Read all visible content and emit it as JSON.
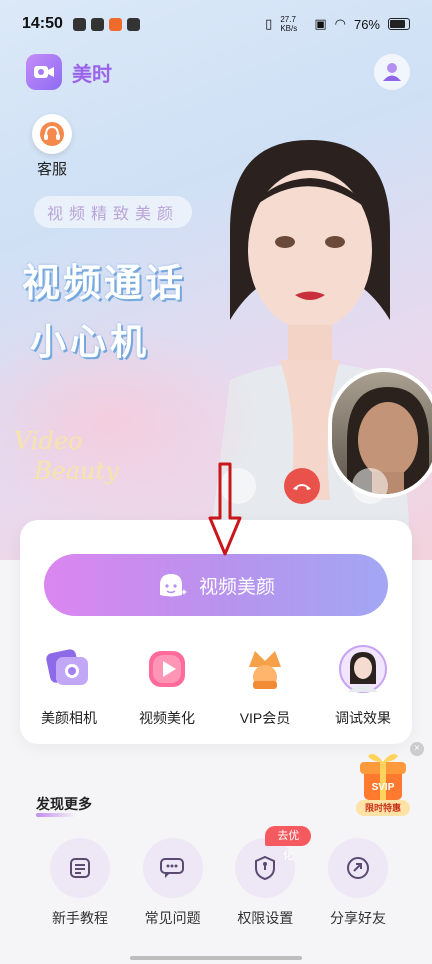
{
  "status_bar": {
    "time": "14:50",
    "network_speed": "27.7 KB/s",
    "battery": "76%"
  },
  "app": {
    "name": "美时"
  },
  "hero": {
    "service_label": "客服",
    "tagline": "视频精致美颜",
    "headline_line1": "视频通话",
    "headline_line2": "小心机",
    "script_line1": "Video",
    "script_line2": "Beauty"
  },
  "main_button": {
    "label": "视频美颜"
  },
  "features": [
    {
      "label": "美颜相机",
      "icon": "camera-icon"
    },
    {
      "label": "视频美化",
      "icon": "play-icon"
    },
    {
      "label": "VIP会员",
      "icon": "crown-icon"
    },
    {
      "label": "调试效果",
      "icon": "avatar-icon"
    }
  ],
  "promo": {
    "badge": "SVIP",
    "label": "限时特惠"
  },
  "discover": {
    "title": "发现更多",
    "tools": [
      {
        "label": "新手教程",
        "icon": "tutorial-icon"
      },
      {
        "label": "常见问题",
        "icon": "chat-icon"
      },
      {
        "label": "权限设置",
        "icon": "shield-icon",
        "badge": "去优化"
      },
      {
        "label": "分享好友",
        "icon": "share-icon"
      }
    ]
  },
  "colors": {
    "accent": "#9a63e9",
    "button_start": "#db86f0",
    "button_end": "#a2a7f4",
    "badge": "#f45a5f"
  }
}
